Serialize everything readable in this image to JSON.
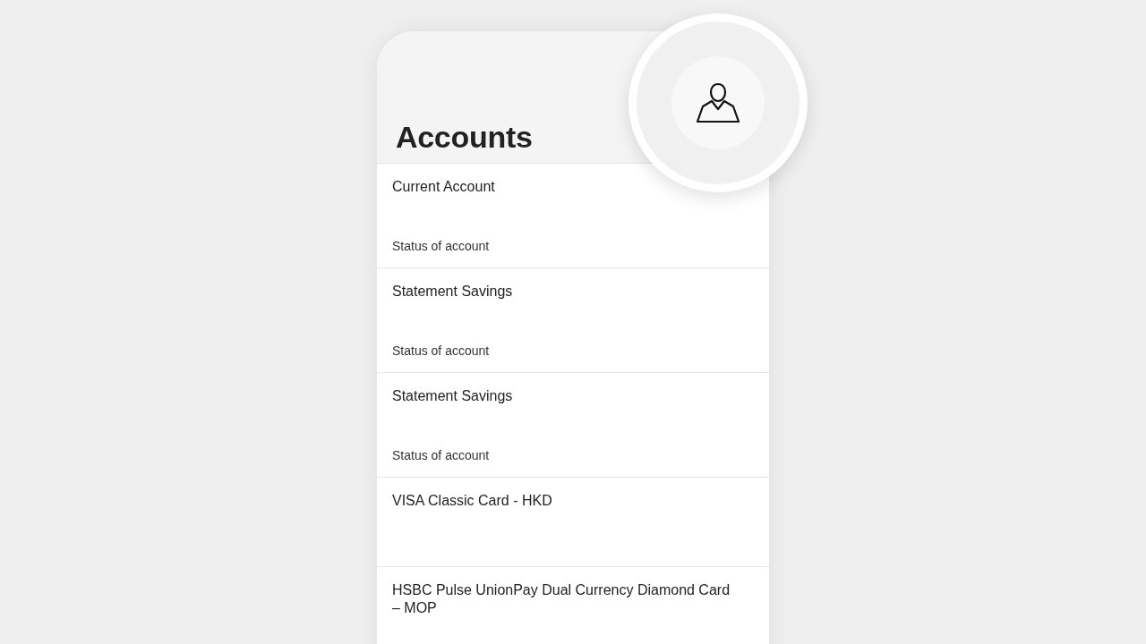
{
  "header": {
    "title": "Accounts"
  },
  "accounts": [
    {
      "name": "Current Account",
      "status": "Status of account"
    },
    {
      "name": "Statement Savings",
      "status": "Status of account"
    },
    {
      "name": "Statement Savings",
      "status": "Status of account"
    },
    {
      "name": "VISA Classic Card - HKD"
    },
    {
      "name": "HSBC Pulse UnionPay Dual Currency Diamond Card – MOP"
    }
  ]
}
